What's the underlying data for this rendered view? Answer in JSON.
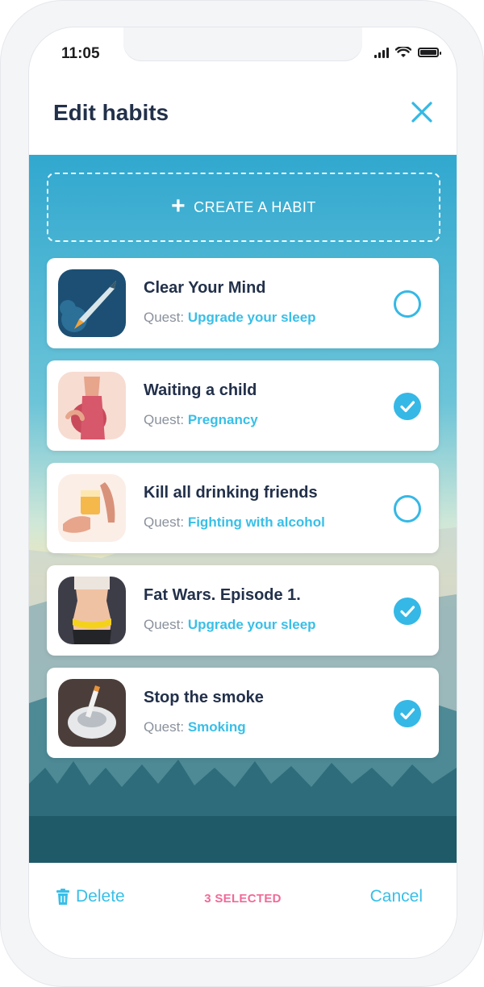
{
  "status_bar": {
    "time": "11:05"
  },
  "header": {
    "title": "Edit habits",
    "close_icon": "close-icon"
  },
  "create_habit": {
    "label": "CREATE A HABIT",
    "icon": "plus-icon"
  },
  "habits": [
    {
      "name": "Clear Your Mind",
      "quest_label": "Quest:",
      "quest": "Upgrade your sleep",
      "selected": false,
      "icon": "rocket-pencil-icon"
    },
    {
      "name": "Waiting a child",
      "quest_label": "Quest:",
      "quest": "Pregnancy",
      "selected": true,
      "icon": "pregnant-woman-icon"
    },
    {
      "name": "Kill all drinking friends",
      "quest_label": "Quest:",
      "quest": "Fighting with alcohol",
      "selected": false,
      "icon": "refuse-drink-icon"
    },
    {
      "name": "Fat Wars. Episode 1.",
      "quest_label": "Quest:",
      "quest": "Upgrade your sleep",
      "selected": true,
      "icon": "waist-measure-icon"
    },
    {
      "name": "Stop the smoke",
      "quest_label": "Quest:",
      "quest": "Smoking",
      "selected": true,
      "icon": "ashtray-icon"
    }
  ],
  "bottom_bar": {
    "delete_label": "Delete",
    "selected_label": "3 SELECTED",
    "cancel_label": "Cancel"
  },
  "colors": {
    "accent": "#35b8e6",
    "title": "#22304a",
    "selected_text": "#f06a99"
  }
}
